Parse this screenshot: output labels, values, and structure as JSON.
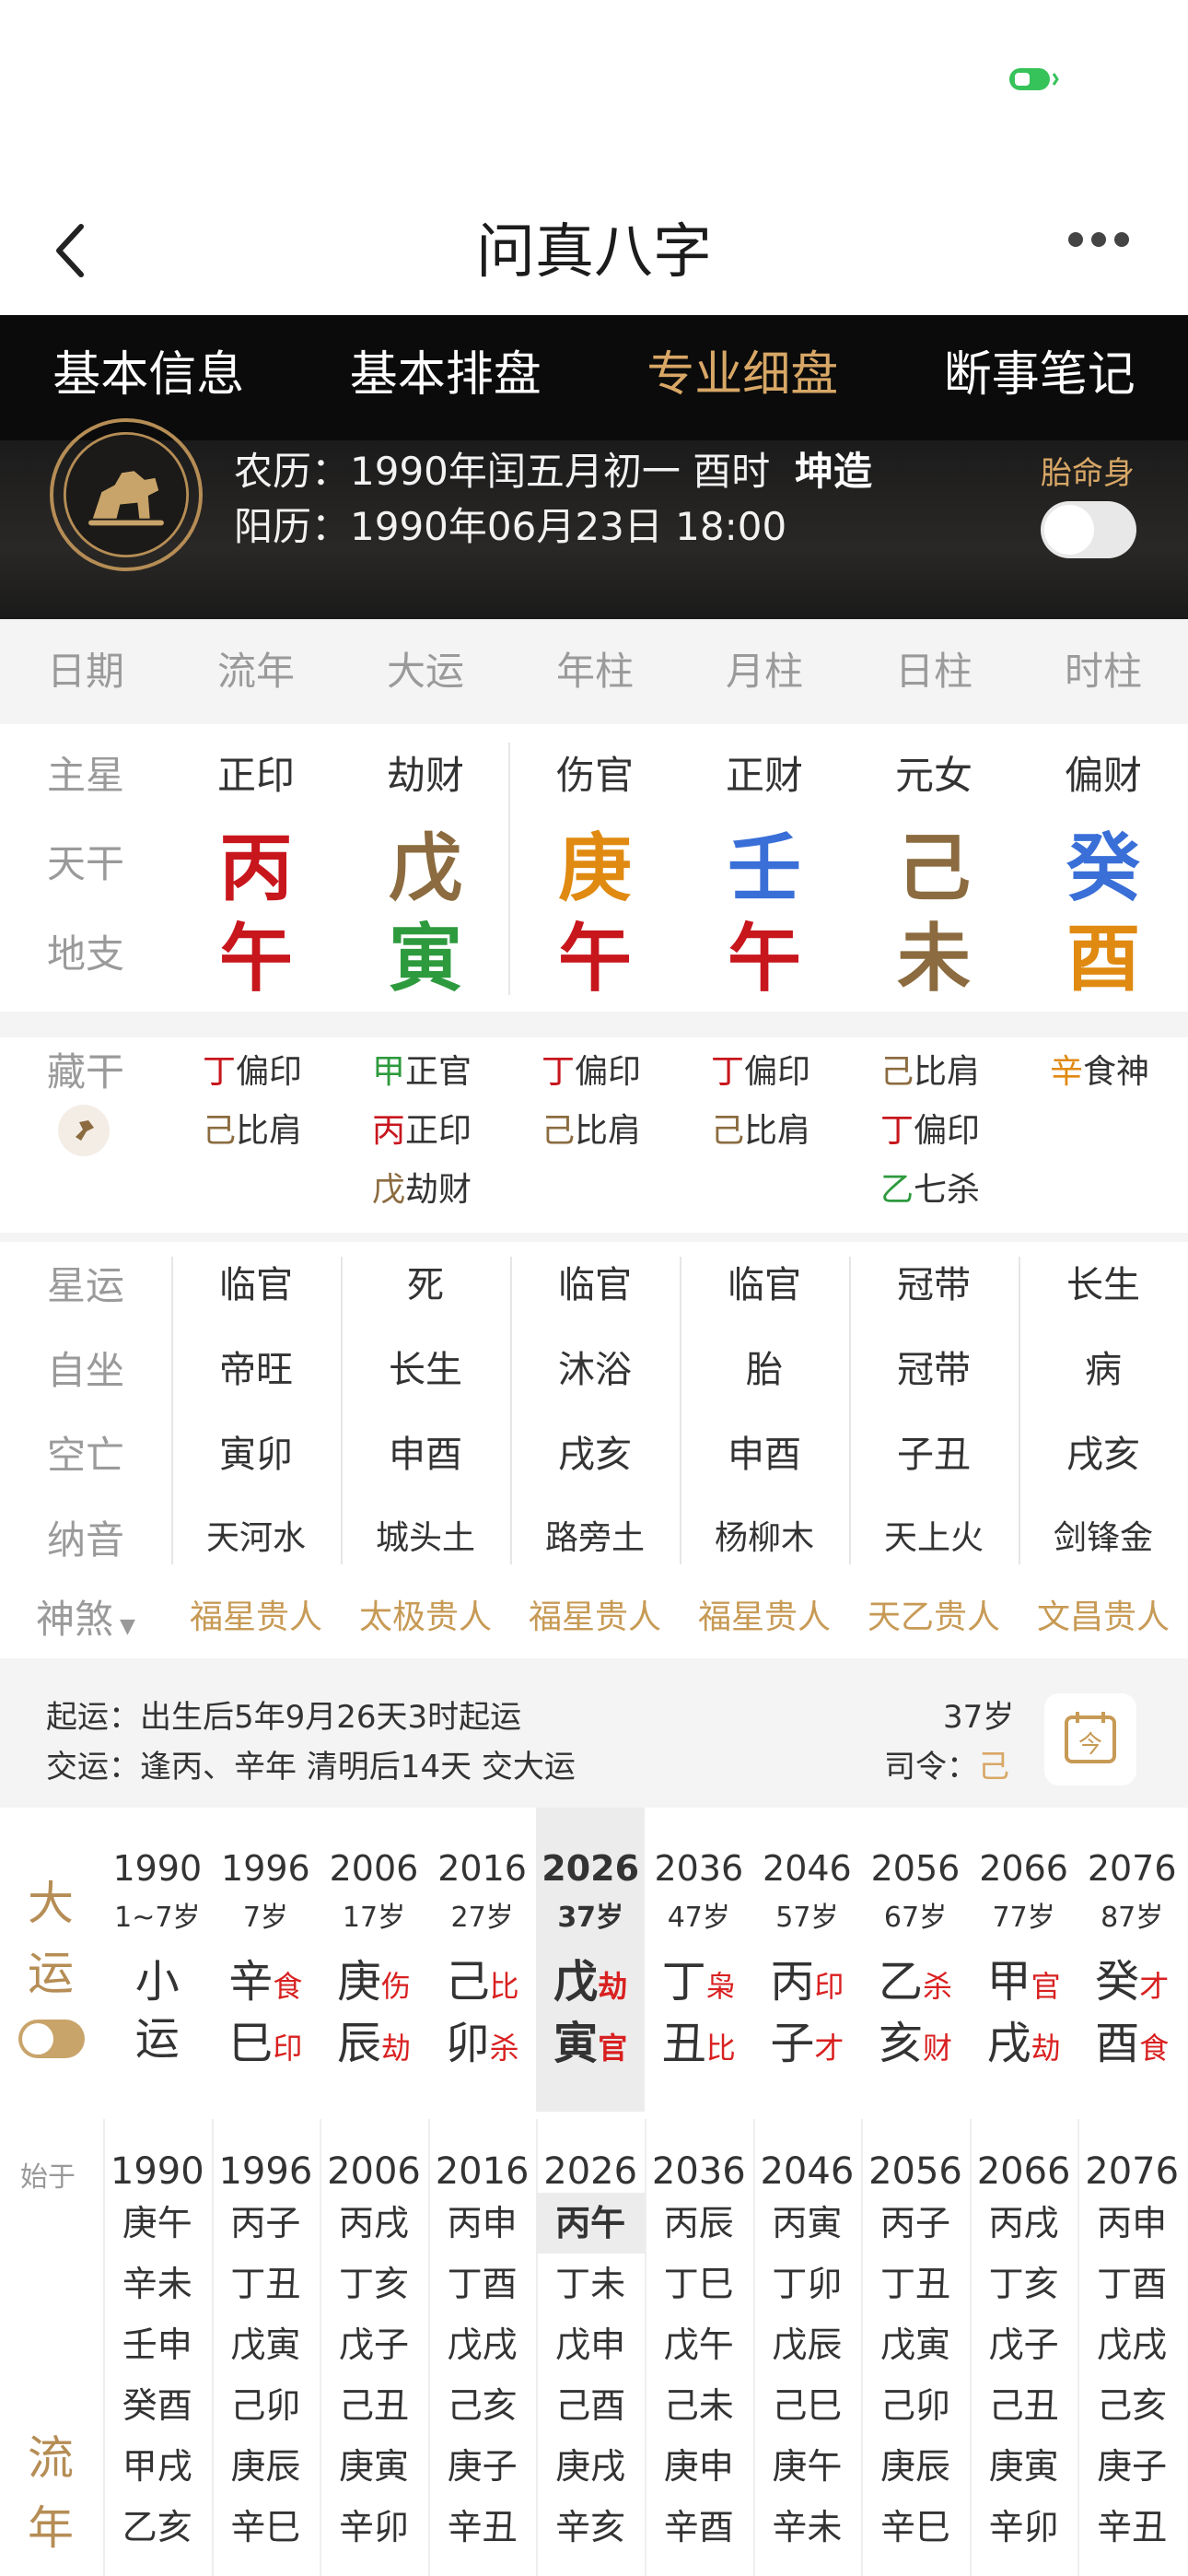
{
  "nav": {
    "title": "问真八字"
  },
  "tabs": [
    "基本信息",
    "基本排盘",
    "专业细盘",
    "断事笔记"
  ],
  "active_tab": 2,
  "banner": {
    "lunar_label": "农历：",
    "lunar_value": "1990年闰五月初一 酉时",
    "gender": "坤造",
    "solar_label": "阳历：",
    "solar_value": "1990年06月23日 18:00",
    "tms_label": "胎命身"
  },
  "columns": [
    "日期",
    "流年",
    "大运",
    "年柱",
    "月柱",
    "日柱",
    "时柱"
  ],
  "row_labels": {
    "main_star": "主星",
    "tiangan": "天干",
    "dizhi": "地支",
    "canggan": "藏干",
    "xingyun": "星运",
    "zizuo": "自坐",
    "kongwang": "空亡",
    "nayin": "纳音",
    "shensha": "神煞"
  },
  "main_star": [
    "正印",
    "劫财",
    "伤官",
    "正财",
    "元女",
    "偏财"
  ],
  "tiangan": [
    {
      "t": "丙",
      "color": "#c8161d"
    },
    {
      "t": "戊",
      "color": "#8b6b3f"
    },
    {
      "t": "庚",
      "color": "#e08a12"
    },
    {
      "t": "壬",
      "color": "#3a6fd8"
    },
    {
      "t": "己",
      "color": "#8b6b3f"
    },
    {
      "t": "癸",
      "color": "#3a6fd8"
    }
  ],
  "dizhi": [
    {
      "t": "午",
      "color": "#c8161d"
    },
    {
      "t": "寅",
      "color": "#2e9a3e"
    },
    {
      "t": "午",
      "color": "#c8161d"
    },
    {
      "t": "午",
      "color": "#c8161d"
    },
    {
      "t": "未",
      "color": "#8b6b3f"
    },
    {
      "t": "酉",
      "color": "#e08a12"
    }
  ],
  "canggan": [
    [
      {
        "g": "丁",
        "c": "#c8161d",
        "s": "偏印"
      },
      {
        "g": "己",
        "c": "#8b6b3f",
        "s": "比肩"
      }
    ],
    [
      {
        "g": "甲",
        "c": "#2e9a3e",
        "s": "正官"
      },
      {
        "g": "丙",
        "c": "#c8161d",
        "s": "正印"
      },
      {
        "g": "戊",
        "c": "#8b6b3f",
        "s": "劫财"
      }
    ],
    [
      {
        "g": "丁",
        "c": "#c8161d",
        "s": "偏印"
      },
      {
        "g": "己",
        "c": "#8b6b3f",
        "s": "比肩"
      }
    ],
    [
      {
        "g": "丁",
        "c": "#c8161d",
        "s": "偏印"
      },
      {
        "g": "己",
        "c": "#8b6b3f",
        "s": "比肩"
      }
    ],
    [
      {
        "g": "己",
        "c": "#8b6b3f",
        "s": "比肩"
      },
      {
        "g": "丁",
        "c": "#c8161d",
        "s": "偏印"
      },
      {
        "g": "乙",
        "c": "#2e9a3e",
        "s": "七杀"
      }
    ],
    [
      {
        "g": "辛",
        "c": "#e08a12",
        "s": "食神"
      }
    ]
  ],
  "xingyun": [
    "临官",
    "死",
    "临官",
    "临官",
    "冠带",
    "长生"
  ],
  "zizuo": [
    "帝旺",
    "长生",
    "沐浴",
    "胎",
    "冠带",
    "病"
  ],
  "kongwang": [
    "寅卯",
    "申酉",
    "戌亥",
    "申酉",
    "子丑",
    "戌亥"
  ],
  "nayin": [
    "天河水",
    "城头土",
    "路旁土",
    "杨柳木",
    "天上火",
    "剑锋金"
  ],
  "shensha": [
    "福星贵人",
    "太极贵人",
    "福星贵人",
    "福星贵人",
    "天乙贵人",
    "文昌贵人"
  ],
  "qiyun": {
    "line1": "起运：出生后5年9月26天3时起运",
    "line2": "交运：逢丙、辛年 清明后14天 交大运",
    "age": "37岁",
    "siling_label": "司令：",
    "siling_value": "己"
  },
  "dayun": {
    "label1": "大",
    "label2": "运",
    "xiaoyun": {
      "year": "1990",
      "age": "1~7岁",
      "top": "小",
      "bottom": "运"
    },
    "items": [
      {
        "year": "1996",
        "age": "7岁",
        "g": "辛",
        "gs": "食",
        "z": "巳",
        "zs": "印"
      },
      {
        "year": "2006",
        "age": "17岁",
        "g": "庚",
        "gs": "伤",
        "z": "辰",
        "zs": "劫"
      },
      {
        "year": "2016",
        "age": "27岁",
        "g": "己",
        "gs": "比",
        "z": "卯",
        "zs": "杀"
      },
      {
        "year": "2026",
        "age": "37岁",
        "g": "戊",
        "gs": "劫",
        "z": "寅",
        "zs": "官"
      },
      {
        "year": "2036",
        "age": "47岁",
        "g": "丁",
        "gs": "枭",
        "z": "丑",
        "zs": "比"
      },
      {
        "year": "2046",
        "age": "57岁",
        "g": "丙",
        "gs": "印",
        "z": "子",
        "zs": "才"
      },
      {
        "year": "2056",
        "age": "67岁",
        "g": "乙",
        "gs": "杀",
        "z": "亥",
        "zs": "财"
      },
      {
        "year": "2066",
        "age": "77岁",
        "g": "甲",
        "gs": "官",
        "z": "戌",
        "zs": "劫"
      },
      {
        "year": "2076",
        "age": "87岁",
        "g": "癸",
        "gs": "才",
        "z": "酉",
        "zs": "食"
      }
    ]
  },
  "liunian": {
    "start_label": "始于",
    "label1": "流",
    "label2": "年",
    "cols": [
      {
        "year": "1990",
        "items": [
          "庚午",
          "辛未",
          "壬申",
          "癸酉",
          "甲戌",
          "乙亥"
        ]
      },
      {
        "year": "1996",
        "items": [
          "丙子",
          "丁丑",
          "戊寅",
          "己卯",
          "庚辰",
          "辛巳"
        ]
      },
      {
        "year": "2006",
        "items": [
          "丙戌",
          "丁亥",
          "戊子",
          "己丑",
          "庚寅",
          "辛卯"
        ]
      },
      {
        "year": "2016",
        "items": [
          "丙申",
          "丁酉",
          "戊戌",
          "己亥",
          "庚子",
          "辛丑"
        ]
      },
      {
        "year": "2026",
        "items": [
          "丙午",
          "丁未",
          "戊申",
          "己酉",
          "庚戌",
          "辛亥"
        ]
      },
      {
        "year": "2036",
        "items": [
          "丙辰",
          "丁巳",
          "戊午",
          "己未",
          "庚申",
          "辛酉"
        ]
      },
      {
        "year": "2046",
        "items": [
          "丙寅",
          "丁卯",
          "戊辰",
          "己巳",
          "庚午",
          "辛未"
        ]
      },
      {
        "year": "2056",
        "items": [
          "丙子",
          "丁丑",
          "戊寅",
          "己卯",
          "庚辰",
          "辛巳"
        ]
      },
      {
        "year": "2066",
        "items": [
          "丙戌",
          "丁亥",
          "戊子",
          "己丑",
          "庚寅",
          "辛卯"
        ]
      },
      {
        "year": "2076",
        "items": [
          "丙申",
          "丁酉",
          "戊戌",
          "己亥",
          "庚子",
          "辛丑"
        ]
      }
    ]
  },
  "colors": {
    "accent": "#d8a766",
    "red": "#c8161d",
    "green": "#2e9a3e",
    "blue": "#3a6fd8",
    "brown": "#8b6b3f",
    "orange": "#e08a12"
  }
}
